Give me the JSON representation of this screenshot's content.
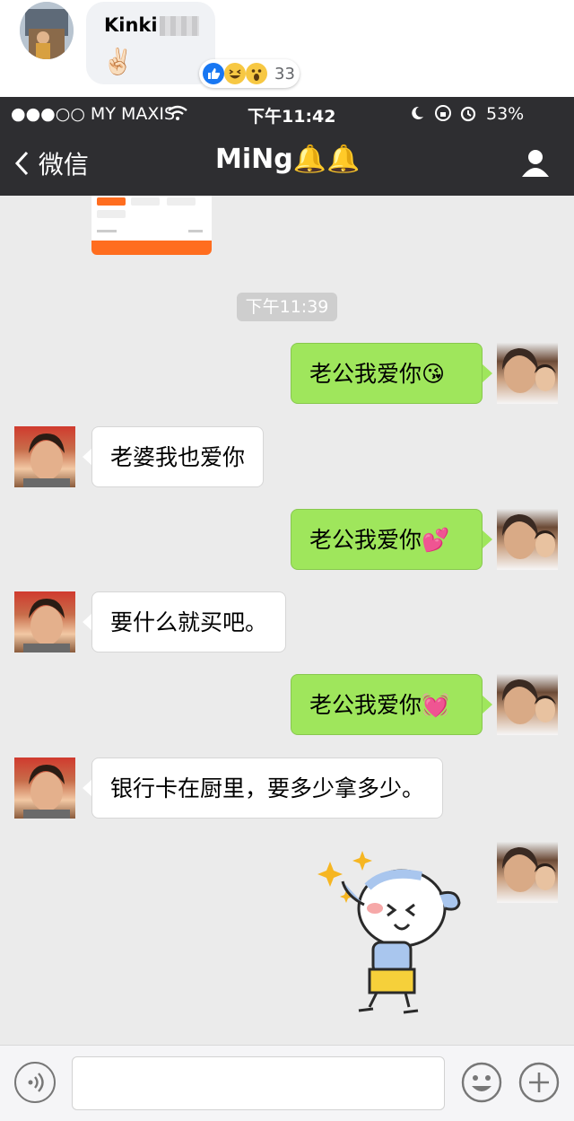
{
  "facebook_comment": {
    "name": "Kinki",
    "emoji": "✌🏻",
    "reaction_count": "33",
    "reactions": [
      "like-icon",
      "haha-icon",
      "wow-icon"
    ]
  },
  "status_bar": {
    "carrier": "●●●○○ MY MAXIS",
    "time": "下午11:42",
    "battery_text": "53%",
    "battery_level": 0.53
  },
  "nav": {
    "back_label": "微信",
    "title": "MiNg🔔🔔"
  },
  "chat": {
    "timestamp": "下午11:39",
    "messages": [
      {
        "side": "out",
        "text": "老公我爱你😘"
      },
      {
        "side": "in",
        "text": "老婆我也爱你"
      },
      {
        "side": "out",
        "text": "老公我爱你💕"
      },
      {
        "side": "in",
        "text": "要什么就买吧。"
      },
      {
        "side": "out",
        "text": "老公我爱你💓"
      },
      {
        "side": "in",
        "text": "银行卡在厨里，要多少拿多少。"
      }
    ]
  },
  "colors": {
    "nav_bg": "#2e2e31",
    "chat_bg": "#ebebeb",
    "bubble_out": "#9fe65c",
    "bubble_in": "#ffffff",
    "fb_like": "#1877f2"
  }
}
